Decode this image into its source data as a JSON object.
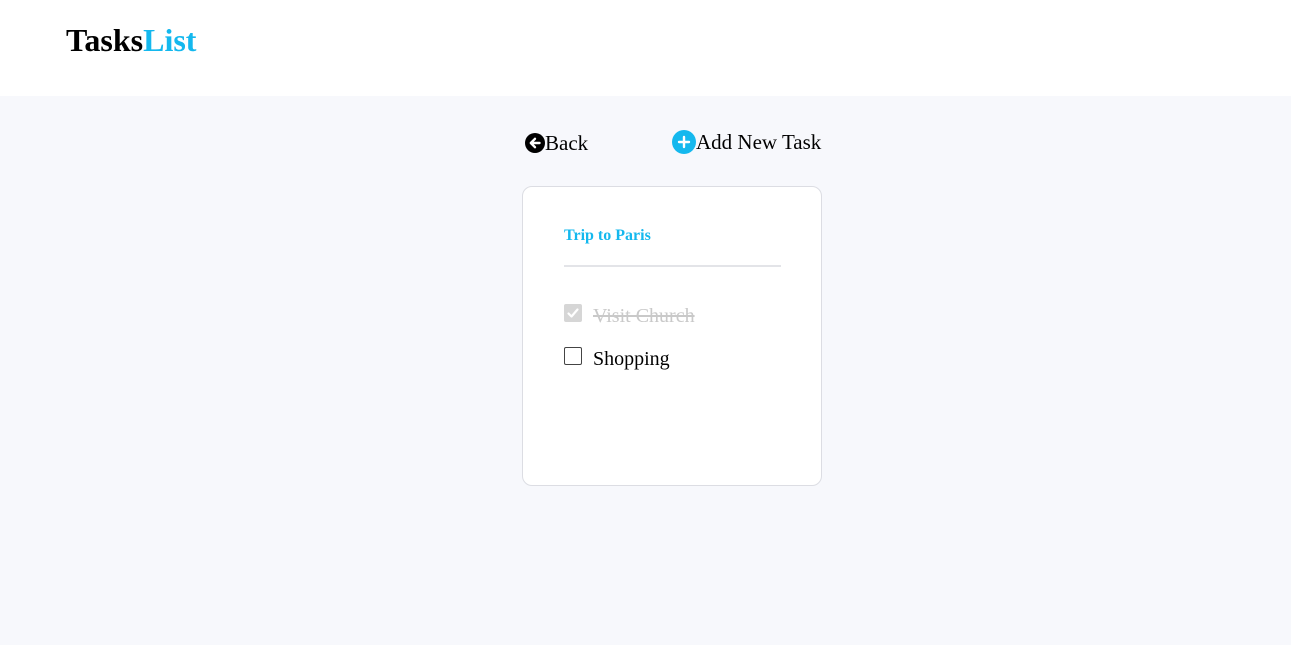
{
  "header": {
    "logo_part1": "Tasks",
    "logo_part2": "List"
  },
  "nav": {
    "back_label": "Back",
    "back_icon": "arrow-left-circle-icon",
    "add_label": "Add New Task",
    "add_icon": "plus-circle-icon"
  },
  "card": {
    "title": "Trip to Paris",
    "tasks": [
      {
        "label": "Visit Church",
        "done": true
      },
      {
        "label": "Shopping",
        "done": false
      }
    ]
  },
  "colors": {
    "accent": "#14b8ee",
    "page_background": "#f7f8fc",
    "done_text": "#c9c9c9"
  }
}
